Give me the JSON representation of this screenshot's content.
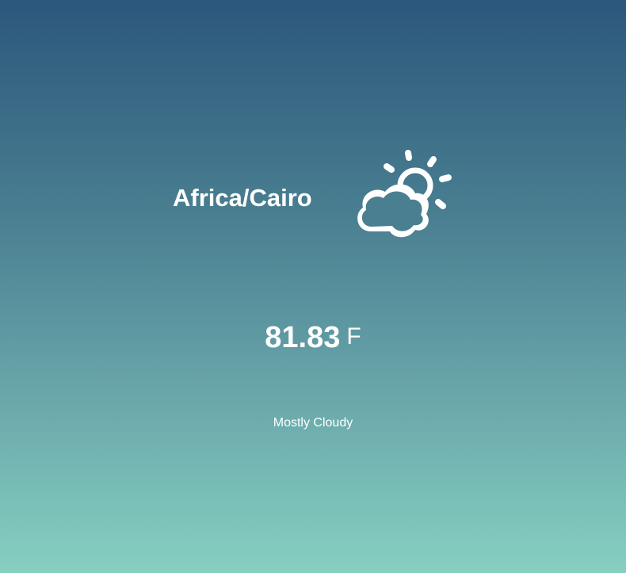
{
  "location": {
    "timezone": "Africa/Cairo"
  },
  "current": {
    "temperature": "81.83",
    "unit": "F",
    "summary": "Mostly Cloudy",
    "icon": "partly-cloudy-day-icon"
  },
  "theme": {
    "gradient_top": "#2b577c",
    "gradient_bottom": "#87cfc1",
    "text_color": "#ffffff"
  }
}
